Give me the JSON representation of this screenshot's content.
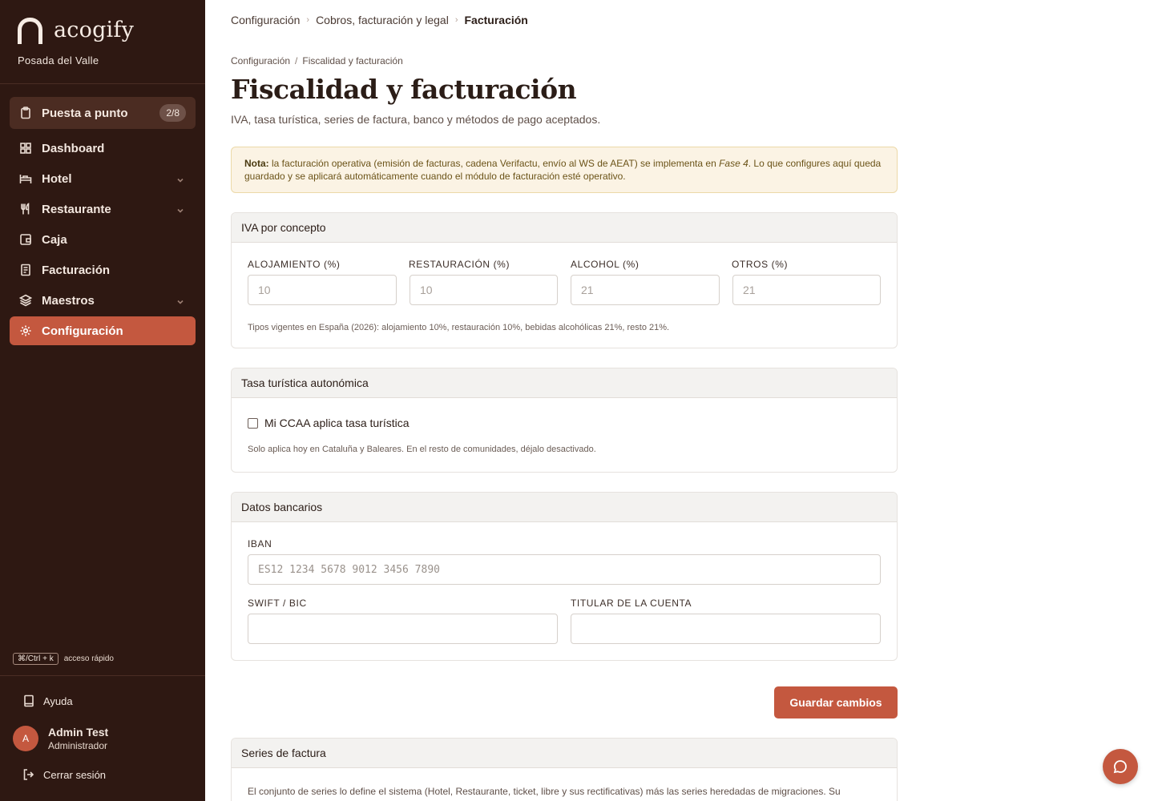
{
  "sidebar": {
    "brand": "acogify",
    "hotel": "Posada del Valle",
    "setup": {
      "label": "Puesta a punto",
      "badge": "2/8"
    },
    "items": [
      {
        "label": "Dashboard",
        "icon": "grid-icon"
      },
      {
        "label": "Hotel",
        "icon": "bed-icon"
      },
      {
        "label": "Restaurante",
        "icon": "utensils-icon"
      },
      {
        "label": "Caja",
        "icon": "wallet-icon"
      },
      {
        "label": "Facturación",
        "icon": "receipt-icon"
      },
      {
        "label": "Maestros",
        "icon": "layers-icon"
      },
      {
        "label": "Configuración",
        "icon": "gear-icon"
      }
    ],
    "shortcut_key": "⌘/Ctrl + k",
    "shortcut_label": "acceso rápido",
    "help": "Ayuda",
    "user": {
      "initial": "A",
      "name": "Admin Test",
      "role": "Administrador"
    },
    "logout": "Cerrar sesión",
    "accent": "#c4583f",
    "bg": "#2e1812"
  },
  "breadcrumb_top": [
    "Configuración",
    "Cobros, facturación y legal",
    "Facturación"
  ],
  "breadcrumb_sub": [
    "Configuración",
    "Fiscalidad y facturación"
  ],
  "page": {
    "title": "Fiscalidad y facturación",
    "subtitle": "IVA, tasa turística, series de factura, banco y métodos de pago aceptados."
  },
  "note": {
    "bold": "Nota:",
    "text1": " la facturación operativa (emisión de facturas, cadena Verifactu, envío al WS de AEAT) se implementa en ",
    "italic": "Fase 4",
    "text2": ". Lo que configures aquí queda guardado y se aplicará automáticamente cuando el módulo de facturación esté operativo."
  },
  "iva": {
    "title": "IVA por concepto",
    "fields": [
      {
        "label": "ALOJAMIENTO (%)",
        "placeholder": "10"
      },
      {
        "label": "RESTAURACIÓN (%)",
        "placeholder": "10"
      },
      {
        "label": "ALCOHOL (%)",
        "placeholder": "21"
      },
      {
        "label": "OTROS (%)",
        "placeholder": "21"
      }
    ],
    "hint": "Tipos vigentes en España (2026): alojamiento 10%, restauración 10%, bebidas alcohólicas 21%, resto 21%."
  },
  "tasa": {
    "title": "Tasa turística autonómica",
    "checkbox_label": "Mi CCAA aplica tasa turística",
    "checked": false,
    "hint": "Solo aplica hoy en Cataluña y Baleares. En el resto de comunidades, déjalo desactivado."
  },
  "banco": {
    "title": "Datos bancarios",
    "iban_label": "IBAN",
    "iban_placeholder": "ES12 1234 5678 9012 3456 7890",
    "swift_label": "SWIFT / BIC",
    "swift_value": "",
    "titular_label": "TITULAR DE LA CUENTA",
    "titular_value": ""
  },
  "save_label": "Guardar cambios",
  "series": {
    "title": "Series de factura",
    "text": "El conjunto de series lo define el sistema (Hotel, Restaurante, ticket, libre y sus rectificativas) más las series heredadas de migraciones. Su"
  }
}
